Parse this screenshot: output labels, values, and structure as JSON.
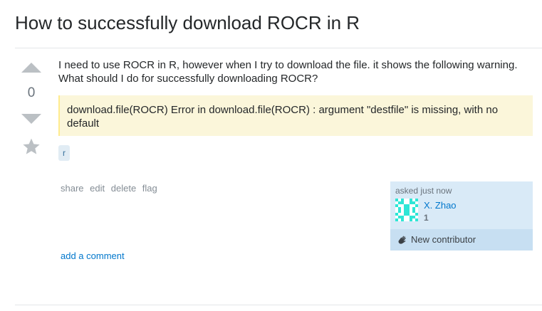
{
  "question": {
    "title": "How to successfully download ROCR in R",
    "body": "I need to use ROCR in R, however when I try to download the file. it shows the following warning. What should I do for successfully downloading ROCR?",
    "code": "download.file(ROCR) Error in download.file(ROCR) : argument \"destfile\" is missing, with no default",
    "tags": [
      "r"
    ]
  },
  "votes": {
    "count": "0",
    "up_icon": "arrow-up-icon",
    "down_icon": "arrow-down-icon",
    "favorite_icon": "star-icon"
  },
  "post_menu": [
    "share",
    "edit",
    "delete",
    "flag"
  ],
  "user_card": {
    "action": "asked just now",
    "name": "X. Zhao",
    "reputation": "1",
    "badge": "New contributor",
    "badge_icon": "waving-hand-icon",
    "avatar_icon": "identicon-avatar"
  },
  "comments": {
    "add_label": "add a comment"
  },
  "colors": {
    "link": "#0077cc",
    "tag_bg": "#e1ecf4",
    "code_bg": "#fbf6da",
    "card_bg": "#d9eaf7",
    "identicon": "#2ee6d6"
  }
}
